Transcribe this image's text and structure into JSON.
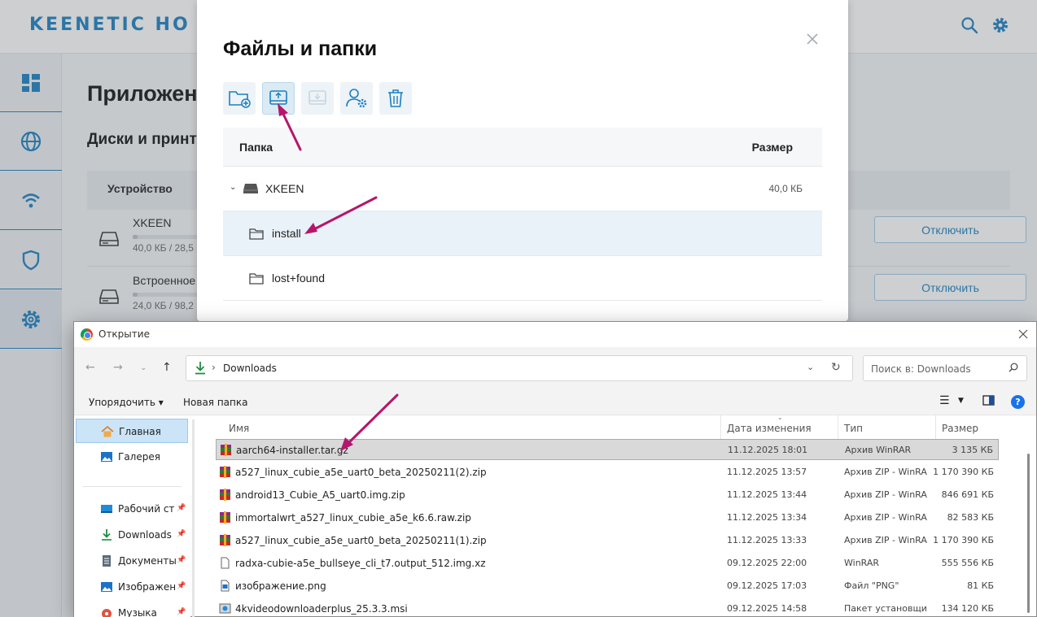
{
  "keenetic": {
    "logo": "KEENETIC HO",
    "page_title": "Приложен",
    "section_title": "Диски и принт",
    "table_col_device": "Устройство",
    "disks": [
      {
        "name": "XKEEN",
        "size": "40,0 КБ / 28,5",
        "used_fraction": 0.05,
        "action": "Отключить"
      },
      {
        "name": "Встроенное",
        "size": "24,0 КБ / 98,2",
        "used_fraction": 0.05,
        "action": "Отключить"
      }
    ]
  },
  "file_manager": {
    "title": "Файлы и папки",
    "col_folder": "Папка",
    "col_size": "Размер",
    "root": {
      "name": "XKEEN",
      "size": "40,0 КБ"
    },
    "folders": [
      {
        "name": "install",
        "selected": true
      },
      {
        "name": "lost+found",
        "selected": false
      }
    ]
  },
  "open_dialog": {
    "title": "Открытие",
    "address": "Downloads",
    "search_placeholder": "Поиск в: Downloads",
    "cmd_organize": "Упорядочить ▾",
    "cmd_new_folder": "Новая папка",
    "help": "?",
    "nav_items": [
      {
        "label": "Главная",
        "icon": "home-icon",
        "selected": true
      },
      {
        "label": "Галерея",
        "icon": "gallery-icon",
        "selected": false
      },
      {
        "label": "Рабочий стол",
        "icon": "desktop-icon",
        "selected": false
      },
      {
        "label": "Downloads",
        "icon": "download-icon",
        "selected": false
      },
      {
        "label": "Документы",
        "icon": "documents-icon",
        "selected": false
      },
      {
        "label": "Изображения",
        "icon": "pictures-icon",
        "selected": false
      },
      {
        "label": "Музыка",
        "icon": "music-icon",
        "selected": false
      }
    ],
    "columns": {
      "name": "Имя",
      "date": "Дата изменения",
      "type": "Тип",
      "size": "Размер"
    },
    "files": [
      {
        "name": "aarch64-installer.tar.gz",
        "date": "11.12.2025 18:01",
        "type": "Архив WinRAR",
        "size": "3 135 КБ",
        "icon": "winrar-icon",
        "selected": true
      },
      {
        "name": "a527_linux_cubie_a5e_uart0_beta_20250211(2).zip",
        "date": "11.12.2025 13:57",
        "type": "Архив ZIP - WinRAR",
        "size": "1 170 390 КБ",
        "icon": "winrar-icon",
        "selected": false
      },
      {
        "name": "android13_Cubie_A5_uart0.img.zip",
        "date": "11.12.2025 13:44",
        "type": "Архив ZIP - WinRAR",
        "size": "846 691 КБ",
        "icon": "winrar-icon",
        "selected": false
      },
      {
        "name": "immortalwrt_a527_linux_cubie_a5e_k6.6.raw.zip",
        "date": "11.12.2025 13:34",
        "type": "Архив ZIP - WinRAR",
        "size": "82 583 КБ",
        "icon": "winrar-icon",
        "selected": false
      },
      {
        "name": "a527_linux_cubie_a5e_uart0_beta_20250211(1).zip",
        "date": "11.12.2025 13:33",
        "type": "Архив ZIP - WinRAR",
        "size": "1 170 390 КБ",
        "icon": "winrar-icon",
        "selected": false
      },
      {
        "name": "radxa-cubie-a5e_bullseye_cli_t7.output_512.img.xz",
        "date": "09.12.2025 22:00",
        "type": "WinRAR",
        "size": "555 556 КБ",
        "icon": "file-icon",
        "selected": false
      },
      {
        "name": "изображение.png",
        "date": "09.12.2025 17:03",
        "type": "Файл \"PNG\"",
        "size": "81 КБ",
        "icon": "image-file-icon",
        "selected": false
      },
      {
        "name": "4kvideodownloaderplus_25.3.3.msi",
        "date": "09.12.2025 14:58",
        "type": "Пакет установщика",
        "size": "134 120 КБ",
        "icon": "installer-icon",
        "selected": false
      }
    ]
  },
  "colors": {
    "accent": "#1a7fc1",
    "arrow": "#b5166b",
    "selection": "#d9d9d9"
  }
}
